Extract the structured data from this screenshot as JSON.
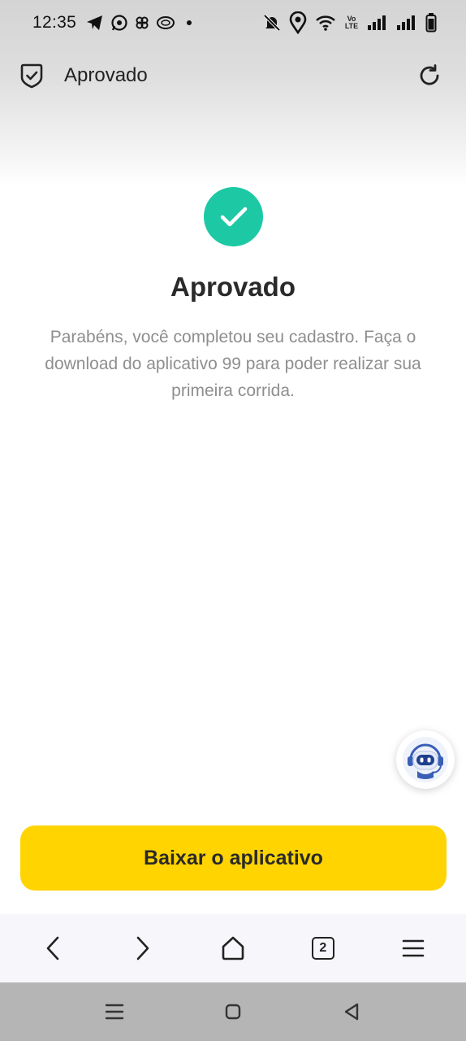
{
  "status_bar": {
    "time": "12:35",
    "left_icons": [
      "telegram-icon",
      "whatsapp-icon",
      "fan-icon",
      "coin-icon",
      "dot-icon"
    ],
    "right_icons": [
      "bell-off-icon",
      "location-icon",
      "wifi-icon",
      "volte-icon",
      "signal-icon",
      "signal-icon",
      "battery-icon"
    ],
    "volte_label": "Vo LTE"
  },
  "header": {
    "title": "Aprovado",
    "left_icon": "shield-check-icon",
    "right_icon": "refresh-icon"
  },
  "main": {
    "badge_icon": "check-icon",
    "badge_color": "#1dc9a4",
    "title": "Aprovado",
    "description": "Parabéns, você completou seu cadastro. Faça o download do aplicativo 99 para poder realizar sua primeira corrida."
  },
  "chatbot": {
    "icon": "robot-assistant-icon"
  },
  "cta": {
    "label": "Baixar o aplicativo",
    "color": "#ffd400"
  },
  "browser_nav": {
    "tab_count": "2",
    "icons": [
      "back-icon",
      "forward-icon",
      "home-icon",
      "tabs-icon",
      "menu-icon"
    ]
  },
  "system_nav": {
    "icons": [
      "recents-icon",
      "home-icon",
      "back-icon"
    ]
  }
}
